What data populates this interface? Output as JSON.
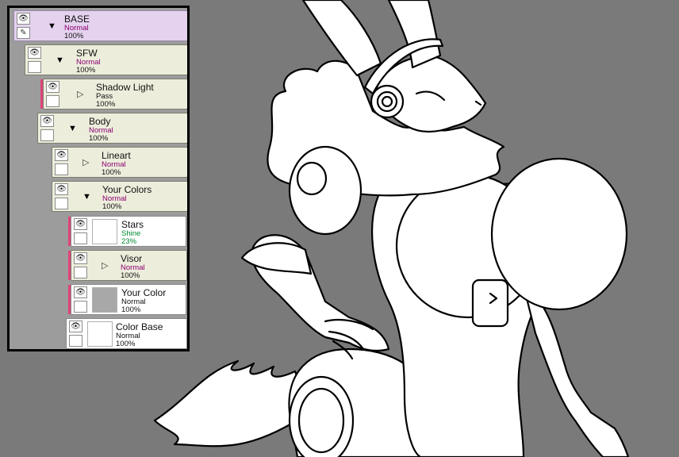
{
  "layers_panel": {
    "layers": [
      {
        "name": "BASE",
        "mode": "Normal",
        "opacity": "100%",
        "expander": "open",
        "selected": true
      },
      {
        "name": "SFW",
        "mode": "Normal",
        "opacity": "100%",
        "expander": "open"
      },
      {
        "name": "Shadow Light",
        "mode": "Pass",
        "opacity": "100%",
        "expander": "closed"
      },
      {
        "name": "Body",
        "mode": "Normal",
        "opacity": "100%",
        "expander": "open"
      },
      {
        "name": "Lineart",
        "mode": "Normal",
        "opacity": "100%",
        "expander": "closed"
      },
      {
        "name": "Your Colors",
        "mode": "Normal",
        "opacity": "100%",
        "expander": "open"
      },
      {
        "name": "Stars",
        "mode": "Shine",
        "opacity": "23%",
        "thumbnail": "white"
      },
      {
        "name": "Visor",
        "mode": "Normal",
        "opacity": "100%",
        "expander": "closed"
      },
      {
        "name": "Your Color",
        "mode": "Normal",
        "opacity": "100%",
        "thumbnail": "gray"
      },
      {
        "name": "Color Base",
        "mode": "Normal",
        "opacity": "100%",
        "thumbnail": "white"
      }
    ]
  },
  "icons": {
    "eye": "eye-icon",
    "pen": "pen-icon",
    "open": "triangle-down-icon",
    "closed": "triangle-right-icon"
  },
  "colors": {
    "canvas_background": "#7a7a7a",
    "selected_layer": "#e4d2ee",
    "layer_background": "#ededdc",
    "clip_marker": "#e0447b",
    "blend_mode_text": "#8a0070",
    "shine_mode_text": "#008a30"
  }
}
